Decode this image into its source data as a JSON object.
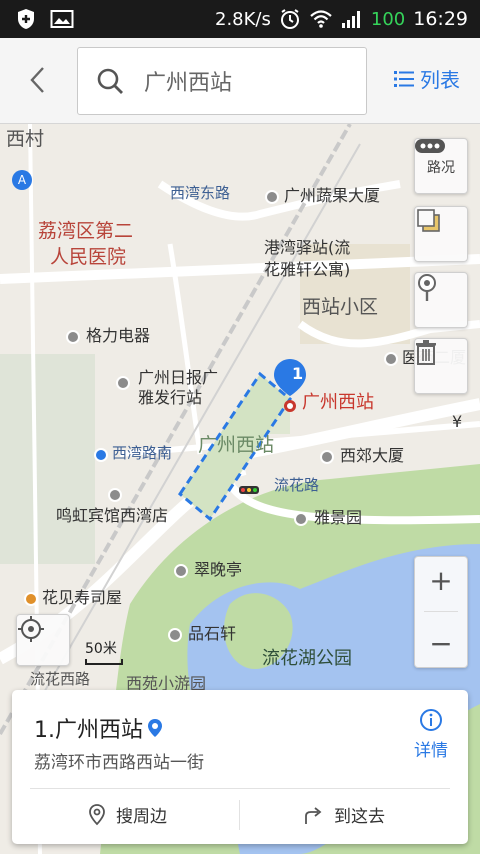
{
  "status_bar": {
    "speed": "2.8K/s",
    "battery": "100",
    "time": "16:29"
  },
  "header": {
    "search_text": "广州西站",
    "list_label": "列表"
  },
  "map": {
    "labels": {
      "xicun": "西村",
      "xiwan_east_road": "西湾东路",
      "guangzhou_fruit_building": "广州蔬果大厦",
      "hospital_line1": "荔湾区第二",
      "hospital_line2": "人民医院",
      "gangwan_line1": "港湾驿站(流",
      "gangwan_line2": "花雅轩公寓)",
      "xizhan_community": "西站小区",
      "gree": "格力电器",
      "medicine": "医药二厦",
      "gz_daily_line1": "广州日报广",
      "gz_daily_line2": "雅发行站",
      "station_label": "广州西站",
      "station_area": "广州西站",
      "xiwan_road": "西湾路南",
      "xijiao_building": "西郊大厦",
      "liuhua_road": "流花路",
      "minghong_hotel": "鸣虹宾馆西湾店",
      "yajing_garden": "雅景园",
      "cuiwan_pavilion": "翠晚亭",
      "sushi": "花见寿司屋",
      "pinshi_xuan": "品石轩",
      "liuhua_park": "流花湖公园",
      "xiyuan_garden": "西苑小游园",
      "liuhua_xilu": "流花西路",
      "yen": "¥"
    },
    "controls": {
      "traffic": "路况",
      "zoom_in": "+",
      "zoom_out": "−"
    },
    "marker_number": "1",
    "scale_label": "50米"
  },
  "result_card": {
    "title": "1.广州西站",
    "address": "荔湾环市西路西站一街",
    "detail_label": "详情",
    "nearby_label": "搜周边",
    "goto_label": "到这去"
  },
  "colors": {
    "accent": "#2a79e4",
    "park_green": "#bfdba5",
    "water": "#a4c3f0",
    "station_red": "#c8372d"
  }
}
